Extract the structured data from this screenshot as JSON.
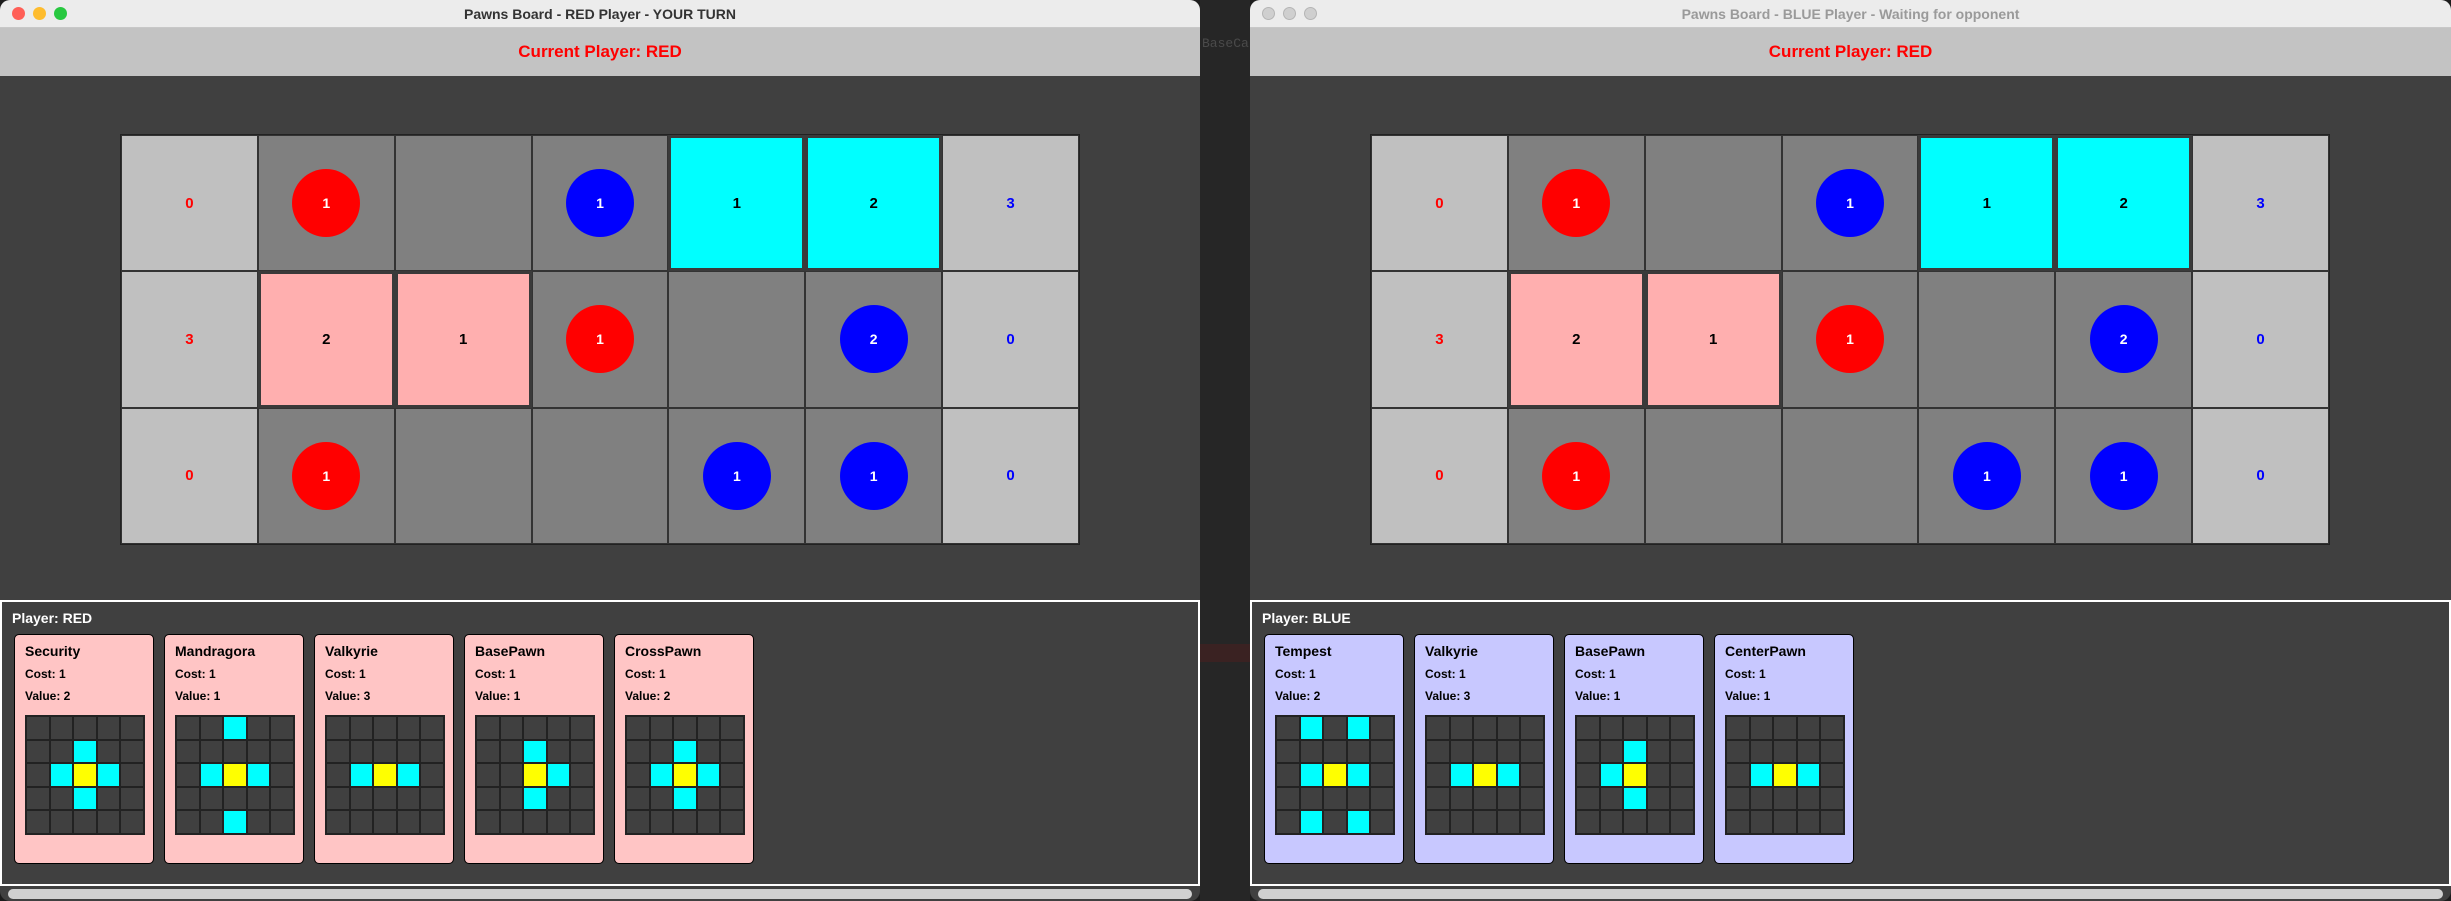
{
  "red_window": {
    "title": "Pawns Board - RED Player - YOUR TURN",
    "current_player": "Current Player: RED",
    "hand_label": "Player: RED",
    "cards": [
      {
        "name": "Security",
        "cost": "Cost: 1",
        "value": "Value: 2",
        "grid": [
          ".....",
          "..c..",
          ".cyc.",
          "..c..",
          "....."
        ]
      },
      {
        "name": "Mandragora",
        "cost": "Cost: 1",
        "value": "Value: 1",
        "grid": [
          "..c..",
          ".....",
          ".cyc.",
          ".....",
          "..c.."
        ]
      },
      {
        "name": "Valkyrie",
        "cost": "Cost: 1",
        "value": "Value: 3",
        "grid": [
          ".....",
          ".....",
          ".cyc.",
          ".....",
          "....."
        ]
      },
      {
        "name": "BasePawn",
        "cost": "Cost: 1",
        "value": "Value: 1",
        "grid": [
          ".....",
          "..c..",
          "..yc.",
          "..c..",
          "....."
        ]
      },
      {
        "name": "CrossPawn",
        "cost": "Cost: 1",
        "value": "Value: 2",
        "grid": [
          ".....",
          "..c..",
          ".cyc.",
          "..c..",
          "....."
        ]
      }
    ]
  },
  "blue_window": {
    "title": "Pawns Board - BLUE Player - Waiting for opponent",
    "current_player": "Current Player: RED",
    "hand_label": "Player: BLUE",
    "cards": [
      {
        "name": "Tempest",
        "cost": "Cost: 1",
        "value": "Value: 2",
        "grid": [
          ".c.c.",
          ".....",
          ".cyc.",
          ".....",
          ".c.c."
        ]
      },
      {
        "name": "Valkyrie",
        "cost": "Cost: 1",
        "value": "Value: 3",
        "grid": [
          ".....",
          ".....",
          ".cyc.",
          ".....",
          "....."
        ]
      },
      {
        "name": "BasePawn",
        "cost": "Cost: 1",
        "value": "Value: 1",
        "grid": [
          ".....",
          "..c..",
          ".cy..",
          "..c..",
          "....."
        ]
      },
      {
        "name": "CenterPawn",
        "cost": "Cost: 1",
        "value": "Value: 1",
        "grid": [
          ".....",
          ".....",
          ".cyc.",
          ".....",
          "....."
        ]
      }
    ]
  },
  "board": {
    "rows": [
      [
        {
          "kind": "score",
          "owner": "red",
          "text": "0"
        },
        {
          "kind": "pawn",
          "owner": "red",
          "text": "1"
        },
        {
          "kind": "empty",
          "text": ""
        },
        {
          "kind": "pawn",
          "owner": "blue",
          "text": "1"
        },
        {
          "kind": "card",
          "owner": "blue",
          "text": "1"
        },
        {
          "kind": "card",
          "owner": "blue",
          "text": "2"
        },
        {
          "kind": "score",
          "owner": "blue",
          "text": "3"
        }
      ],
      [
        {
          "kind": "score",
          "owner": "red",
          "text": "3"
        },
        {
          "kind": "card",
          "owner": "red",
          "text": "2"
        },
        {
          "kind": "card",
          "owner": "red",
          "text": "1"
        },
        {
          "kind": "pawn",
          "owner": "red",
          "text": "1"
        },
        {
          "kind": "empty",
          "text": ""
        },
        {
          "kind": "pawn",
          "owner": "blue",
          "text": "2"
        },
        {
          "kind": "score",
          "owner": "blue",
          "text": "0"
        }
      ],
      [
        {
          "kind": "score",
          "owner": "red",
          "text": "0"
        },
        {
          "kind": "pawn",
          "owner": "red",
          "text": "1"
        },
        {
          "kind": "empty",
          "text": ""
        },
        {
          "kind": "empty",
          "text": ""
        },
        {
          "kind": "pawn",
          "owner": "blue",
          "text": "1"
        },
        {
          "kind": "pawn",
          "owner": "blue",
          "text": "1"
        },
        {
          "kind": "score",
          "owner": "blue",
          "text": "0"
        }
      ]
    ]
  },
  "background_text": "BaseCa",
  "colors": {
    "red": "#ff0000",
    "blue": "#0000ff",
    "cyan": "#00ffff",
    "pink": "#ffafaf",
    "yellow": "#ffff00"
  }
}
